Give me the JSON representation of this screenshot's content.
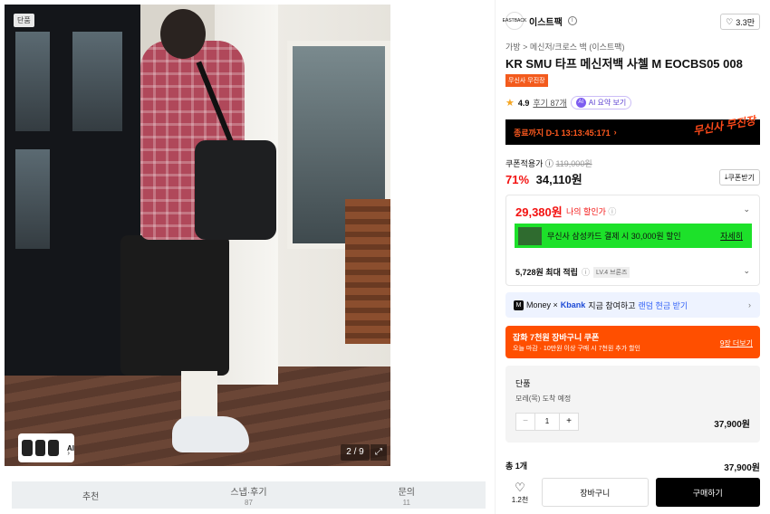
{
  "colors": {
    "accent_red": "#f31110",
    "orange": "#ff4f00",
    "card_green": "#1de12a",
    "link_blue": "#3564f7"
  },
  "image": {
    "badge": "단품",
    "ai_label": "AI",
    "counter": "2 / 9"
  },
  "tabs": [
    {
      "label": "추천",
      "count": ""
    },
    {
      "label": "스냅·후기",
      "count": "87"
    },
    {
      "label": "문의",
      "count": "11"
    }
  ],
  "brand": {
    "logo_text": "EASTBACK",
    "name": "이스트팩",
    "likes": "3.3만"
  },
  "breadcrumb": {
    "cat1": "가방",
    "sep": ">",
    "cat2": "메신저/크로스 백 (이스트팩)"
  },
  "product": {
    "title": "KR SMU 타프 메신저백 사첼 M EOCBS05 008",
    "tag": "무신사 무진장",
    "rating": "4.9",
    "reviews": "후기 87개",
    "ai_summary": "AI 요약 보기"
  },
  "timer_banner": {
    "text": "종료까지 D-1 13:13:45:171",
    "promo": "무신사 무진장"
  },
  "pricing": {
    "coupon_label": "쿠폰적용가",
    "original": "119,000원",
    "discount": "71%",
    "price": "34,110원",
    "coupon_button": "쿠폰받기"
  },
  "my_price": {
    "price": "29,380원",
    "label": "나의 할인가",
    "card_text": "무신사 삼성카드 결제 시 30,000원 할인",
    "card_more": "자세히",
    "points": "5,728원 최대 적립",
    "level": "LV.4 브론즈"
  },
  "money_bar": {
    "prefix": "Money × ",
    "kbank": "Kbank",
    "text": "지금 참여하고",
    "link": "랜덤 현금 받기"
  },
  "cart_coupon": {
    "title": "잡화 7천원 장바구니 쿠폰",
    "subtitle": "오늘 마감 · 10만원 이상 구매 시 7천원 추가 할인",
    "more": "9장 더보기"
  },
  "option": {
    "name": "단품",
    "arrival": "모레(목) 도착 예정",
    "qty": "1",
    "minus": "−",
    "plus": "+",
    "price": "37,900원"
  },
  "total": {
    "label": "총 1개",
    "value": "37,900원"
  },
  "actions": {
    "like_count": "1.2천",
    "cart": "장바구니",
    "buy": "구매하기"
  }
}
